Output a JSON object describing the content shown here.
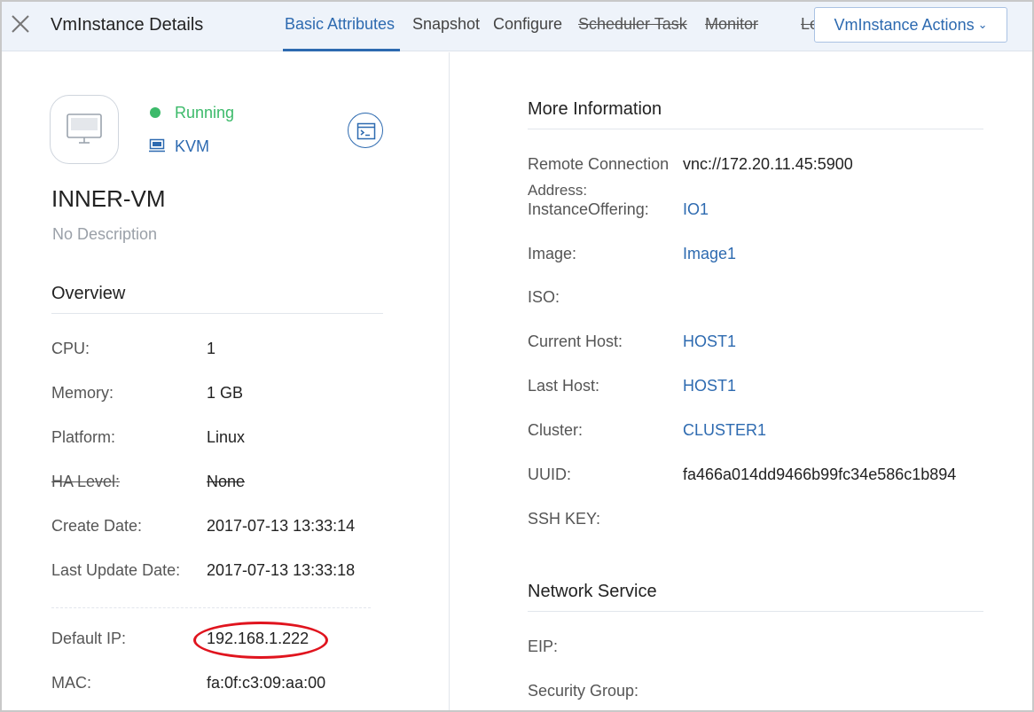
{
  "header": {
    "title": "VmInstance Details",
    "tabs": [
      {
        "label": "Basic Attributes"
      },
      {
        "label": "Snapshot"
      },
      {
        "label": "Configure"
      },
      {
        "label": "Scheduler Task"
      },
      {
        "label": "Monitor"
      },
      {
        "label": "Le"
      }
    ],
    "actions_label": "VmInstance Actions",
    "colors": {
      "accent": "#2d6ab0",
      "header_bg": "#eef3fa"
    }
  },
  "vm": {
    "status": "Running",
    "status_color": "#3cba6a",
    "hypervisor": "KVM",
    "name": "INNER-VM",
    "description": "No Description",
    "icon": "monitor-icon"
  },
  "overview": {
    "title": "Overview",
    "fields": [
      {
        "label": "CPU:",
        "value": "1"
      },
      {
        "label": "Memory:",
        "value": "1 GB"
      },
      {
        "label": "Platform:",
        "value": "Linux"
      },
      {
        "label": "HA Level:",
        "value": "None"
      },
      {
        "label": "Create Date:",
        "value": "2017-07-13 13:33:14"
      },
      {
        "label": "Last Update Date:",
        "value": "2017-07-13 13:33:18"
      }
    ],
    "network": [
      {
        "label": "Default IP:",
        "value": "192.168.1.222"
      },
      {
        "label": "MAC:",
        "value": "fa:0f:c3:09:aa:00"
      }
    ]
  },
  "more_info": {
    "title": "More Information",
    "remote_label_line1": "Remote Connection",
    "remote_label_line2": "Address:",
    "remote_value": "vnc://172.20.11.45:5900",
    "fields": [
      {
        "label": "InstanceOffering:",
        "value": "IO1"
      },
      {
        "label": "Image:",
        "value": "Image1"
      },
      {
        "label": "ISO:",
        "value": ""
      },
      {
        "label": "Current Host:",
        "value": "HOST1"
      },
      {
        "label": "Last Host:",
        "value": "HOST1"
      },
      {
        "label": "Cluster:",
        "value": "CLUSTER1"
      },
      {
        "label": "UUID:",
        "value": "fa466a014dd9466b99fc34e586c1b894"
      },
      {
        "label": "SSH KEY:",
        "value": ""
      }
    ]
  },
  "network_service": {
    "title": "Network Service",
    "fields": [
      {
        "label": "EIP:",
        "value": ""
      },
      {
        "label": "Security Group:",
        "value": ""
      }
    ]
  }
}
